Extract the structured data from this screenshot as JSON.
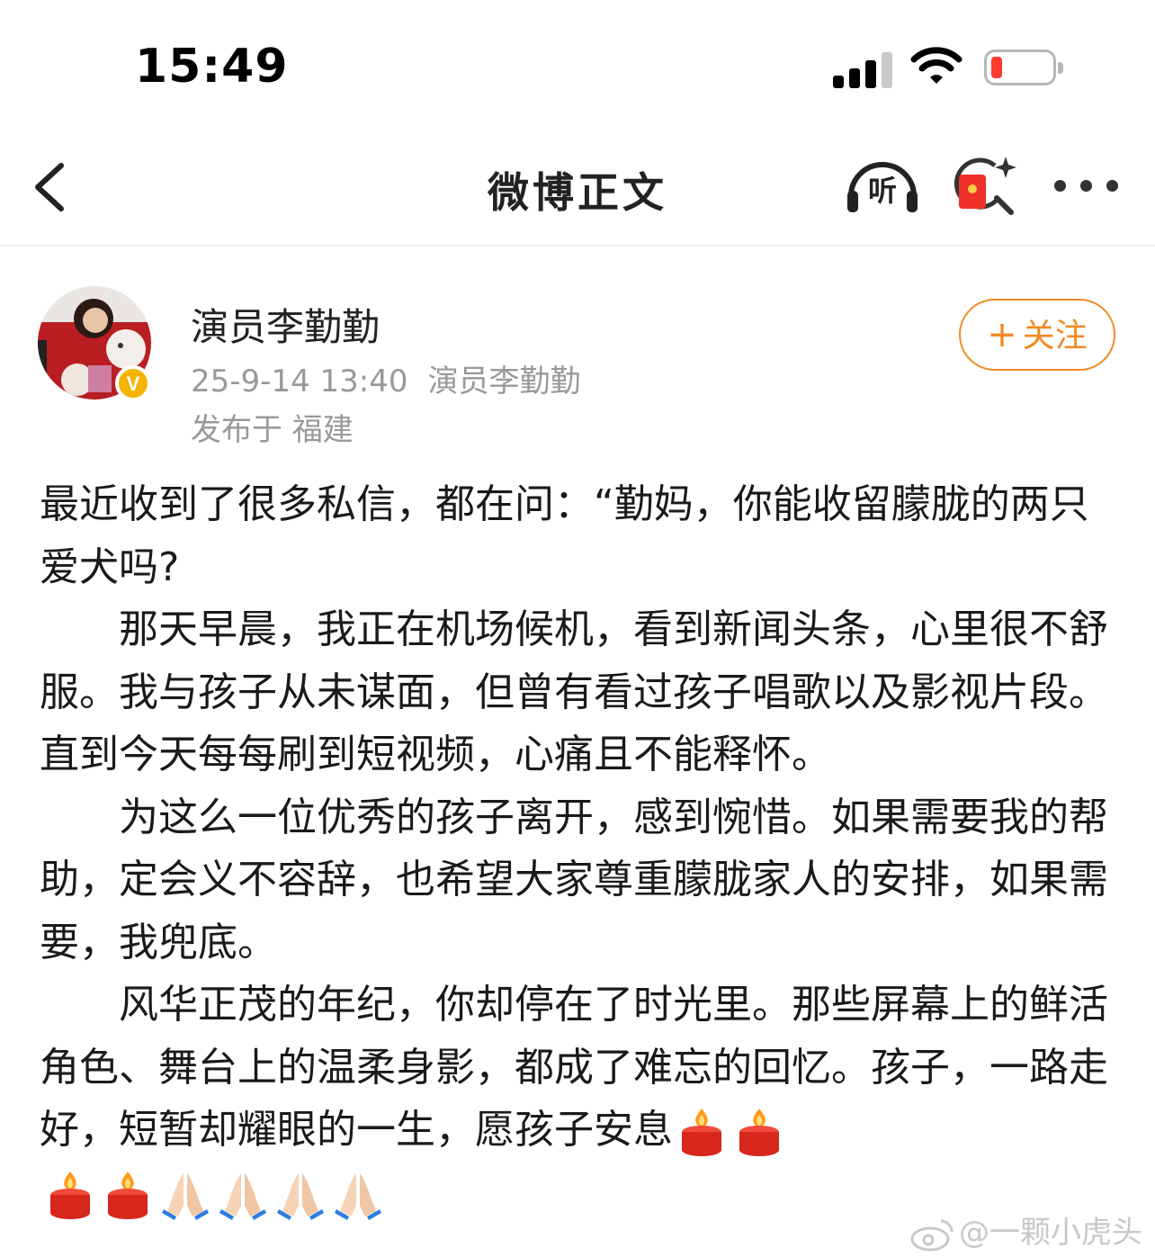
{
  "status_bar": {
    "time": "15:49",
    "battery_color": "#ff3b30"
  },
  "nav": {
    "title": "微博正文",
    "listen_label": "听",
    "back_icon": "chevron-left-icon",
    "more_icon": "ellipsis-icon"
  },
  "post": {
    "author": "演员李勤勤",
    "timestamp": "25-9-14 13:40",
    "source": "演员李勤勤",
    "location": "发布于 福建",
    "follow_label": "关注",
    "verified_badge": "V",
    "paragraphs": [
      "最近收到了很多私信，都在问：“勤妈，你能收留朦胧的两只爱犬吗?",
      "那天早晨，我正在机场候机，看到新闻头条，心里很不舒服。我与孩子从未谋面，但曾有看过孩子唱歌以及影视片段。直到今天每每刷到短视频，心痛且不能释怀。",
      "为这么一位优秀的孩子离开，感到惋惜。如果需要我的帮助，定会义不容辞，也希望大家尊重朦胧家人的安排，如果需要，我兜底。",
      "风华正茂的年纪，你却停在了时光里。那些屏幕上的鲜活角色、舞台上的温柔身影，都成了难忘的回忆。孩子，一路走好，短暂却耀眼的一生，愿孩子安息"
    ],
    "emojis": [
      "candle-icon",
      "candle-icon",
      "candle-icon",
      "candle-icon",
      "praying-hands-icon",
      "praying-hands-icon",
      "praying-hands-icon",
      "praying-hands-icon"
    ]
  },
  "watermark": "@一颗小虎头",
  "colors": {
    "accent": "#f08a24",
    "meta_gray": "#999999",
    "verified": "#f5b400"
  }
}
